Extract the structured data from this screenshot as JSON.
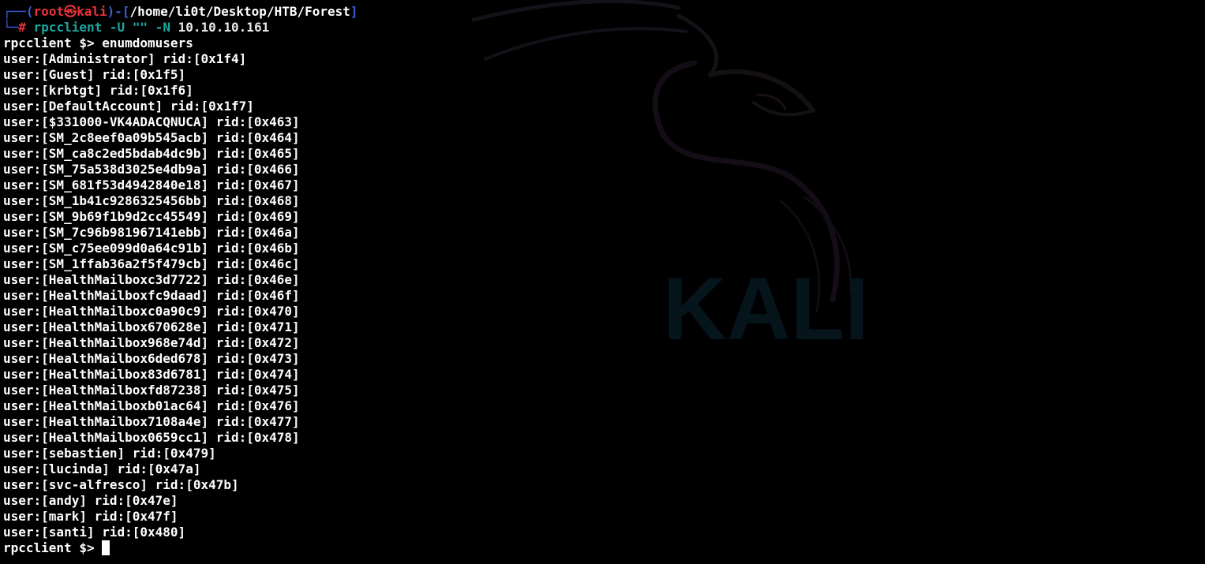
{
  "colors": {
    "background": "#000000",
    "prompt_frame": "#3c5dd6",
    "prompt_user": "#e7333b",
    "command": "#1aa6a0",
    "text": "#ffffff"
  },
  "prompt": {
    "frame_top": "┌──",
    "open_paren": "(",
    "user": "root",
    "skull_icon": "㉿",
    "host": "kali",
    "close_paren": ")",
    "dash": "-",
    "path_open": "[",
    "path": "/home/li0t/Desktop/HTB/Forest",
    "path_close": "]",
    "frame_bottom": "└─",
    "hash": "#",
    "command_name": "rpcclient",
    "command_flag_u": "-U",
    "command_empty_arg": "\"\"",
    "command_flag_n": "-N",
    "command_target": "10.10.10.161"
  },
  "rpc_prompt": "rpcclient $>",
  "rpc_command": "enumdomusers",
  "output_lines": [
    "user:[Administrator] rid:[0x1f4]",
    "user:[Guest] rid:[0x1f5]",
    "user:[krbtgt] rid:[0x1f6]",
    "user:[DefaultAccount] rid:[0x1f7]",
    "user:[$331000-VK4ADACQNUCA] rid:[0x463]",
    "user:[SM_2c8eef0a09b545acb] rid:[0x464]",
    "user:[SM_ca8c2ed5bdab4dc9b] rid:[0x465]",
    "user:[SM_75a538d3025e4db9a] rid:[0x466]",
    "user:[SM_681f53d4942840e18] rid:[0x467]",
    "user:[SM_1b41c9286325456bb] rid:[0x468]",
    "user:[SM_9b69f1b9d2cc45549] rid:[0x469]",
    "user:[SM_7c96b981967141ebb] rid:[0x46a]",
    "user:[SM_c75ee099d0a64c91b] rid:[0x46b]",
    "user:[SM_1ffab36a2f5f479cb] rid:[0x46c]",
    "user:[HealthMailboxc3d7722] rid:[0x46e]",
    "user:[HealthMailboxfc9daad] rid:[0x46f]",
    "user:[HealthMailboxc0a90c9] rid:[0x470]",
    "user:[HealthMailbox670628e] rid:[0x471]",
    "user:[HealthMailbox968e74d] rid:[0x472]",
    "user:[HealthMailbox6ded678] rid:[0x473]",
    "user:[HealthMailbox83d6781] rid:[0x474]",
    "user:[HealthMailboxfd87238] rid:[0x475]",
    "user:[HealthMailboxb01ac64] rid:[0x476]",
    "user:[HealthMailbox7108a4e] rid:[0x477]",
    "user:[HealthMailbox0659cc1] rid:[0x478]",
    "user:[sebastien] rid:[0x479]",
    "user:[lucinda] rid:[0x47a]",
    "user:[svc-alfresco] rid:[0x47b]",
    "user:[andy] rid:[0x47e]",
    "user:[mark] rid:[0x47f]",
    "user:[santi] rid:[0x480]"
  ],
  "wallpaper": {
    "logo_text": "KALI",
    "dragon_icon": "kali-dragon-icon"
  }
}
